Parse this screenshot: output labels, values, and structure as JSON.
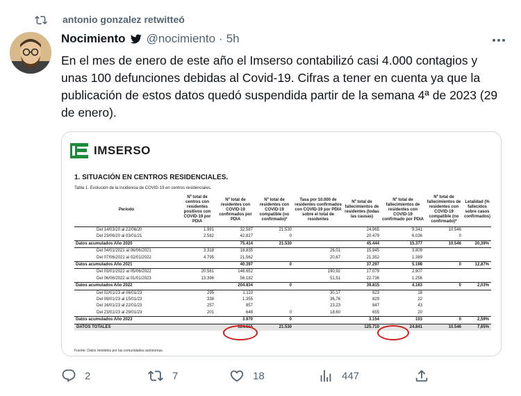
{
  "retweet": {
    "label": "antonio gonzalez retwitteó"
  },
  "tweet": {
    "display_name": "Nocimiento",
    "handle": "@nocimiento",
    "separator": "·",
    "time": "5h",
    "text": "En el mes de enero de este año el Imserso contabilizó casi 4.000 contagios y unas 100 defunciones debidas al Covid-19. Cifras a tener en cuenta ya que la publicación de estos datos quedó suspendida partir de la semana 4ª de 2023 (29 de enero)."
  },
  "image": {
    "logo_text": "IMSERSO",
    "section_title": "1.   SITUACIÓN EN CENTROS RESIDENCIALES.",
    "caption": "Tabla 1. Evolución de la incidencia de COVID-19 en centros residenciales.",
    "headers": [
      "Período",
      "Nº total de centros con residentes positivos con COVID-19 por PDIA",
      "Nº total de residentes con COVID-19 confirmados por PDIA",
      "Nº total de residentes con COVID-19 compatible (no confirmado)*",
      "Tasa por 10.000 de residentes confirmados con COVID-19 por PDIA sobre el total de residentes",
      "Nº total de fallecimientos de residentes (todas las causas)",
      "Nº total de fallecimientos de residentes con COVID-19 confirmado por PDIA",
      "Nº total de fallecimientos de residentes con COVID-19 compatible (no confirmado)*",
      "Letalidad (% fallecidos sobre casos confirmados)"
    ],
    "rows": [
      {
        "type": "period",
        "cells": [
          "Del 14/03/20 al 22/06/20",
          "1.991",
          "32.587",
          "21.530",
          "",
          "24.965",
          "9.341",
          "10.546",
          ""
        ]
      },
      {
        "type": "period",
        "cells": [
          "Del 23/06/20 al 03/01/21",
          "2.582",
          "42.827",
          "0",
          "",
          "20.479",
          "6.036",
          "0",
          ""
        ]
      },
      {
        "type": "acc",
        "cells": [
          "Datos acumulados Año 2020",
          "",
          "75.414",
          "21.530",
          "",
          "45.444",
          "15.377",
          "10.546",
          "20,39%"
        ]
      },
      {
        "type": "period",
        "cells": [
          "Del 04/01/2021 al 06/06/2021",
          "3.318",
          "18.835",
          "",
          "26,01",
          "15.945",
          "3.809",
          "",
          ""
        ]
      },
      {
        "type": "period",
        "cells": [
          "Del 07/06/2021 al 02/01/2022",
          "4.795",
          "21.562",
          "",
          "20,67",
          "21.352",
          "1.389",
          "",
          ""
        ]
      },
      {
        "type": "acc",
        "cells": [
          "Datos acumulados Año 2021",
          "",
          "40.397",
          "0",
          "",
          "37.297",
          "5.198",
          "0",
          "12,87%"
        ]
      },
      {
        "type": "period",
        "cells": [
          "Del 03/01/2022 al 05/06/2022",
          "20.561",
          "148.652",
          "",
          "190,92",
          "17.079",
          "2.907",
          "",
          ""
        ]
      },
      {
        "type": "period",
        "cells": [
          "Del 06/06/2022 al 01/01/2023",
          "13.396",
          "56.182",
          "",
          "51,51",
          "22.736",
          "1.256",
          "",
          ""
        ]
      },
      {
        "type": "acc",
        "cells": [
          "Datos acumulados Año 2022",
          "",
          "204.834",
          "0",
          "",
          "39.815",
          "4.163",
          "0",
          "2,03%"
        ]
      },
      {
        "type": "period",
        "cells": [
          "Del 02/01/23 al 08/01/23",
          "295",
          "1.110",
          "",
          "30,17",
          "823",
          "18",
          "",
          ""
        ]
      },
      {
        "type": "period",
        "cells": [
          "Del 09/01/23 al 15/01/23",
          "338",
          "1.355",
          "",
          "36,76",
          "829",
          "22",
          "",
          ""
        ]
      },
      {
        "type": "period",
        "cells": [
          "Del 16/01/23 al 22/01/23",
          "257",
          "857",
          "",
          "23,23",
          "847",
          "43",
          "",
          ""
        ]
      },
      {
        "type": "period",
        "cells": [
          "Del 23/01/23 al 29/01/23",
          "201",
          "648",
          "0",
          "18,60",
          "655",
          "20",
          "",
          ""
        ]
      },
      {
        "type": "acc",
        "cells": [
          "Datos acumulados Año 2023",
          "",
          "3.970",
          "0",
          "",
          "3.154",
          "103",
          "0",
          "2,59%"
        ]
      },
      {
        "type": "tot",
        "cells": [
          "DATOS TOTALES",
          "",
          "324.615",
          "21.530",
          "",
          "125.710",
          "24.841",
          "10.546",
          "7,65%"
        ]
      }
    ],
    "footnote": "Fuente: Datos remitidos por las comunidades autónomas."
  },
  "actions": {
    "replies": "2",
    "retweets": "7",
    "likes": "18",
    "views": "447"
  },
  "colors": {
    "accent": "#1d9bf0",
    "muted": "#536471",
    "highlight": "#d11a1a",
    "logo_green": "#1c8a3c"
  }
}
